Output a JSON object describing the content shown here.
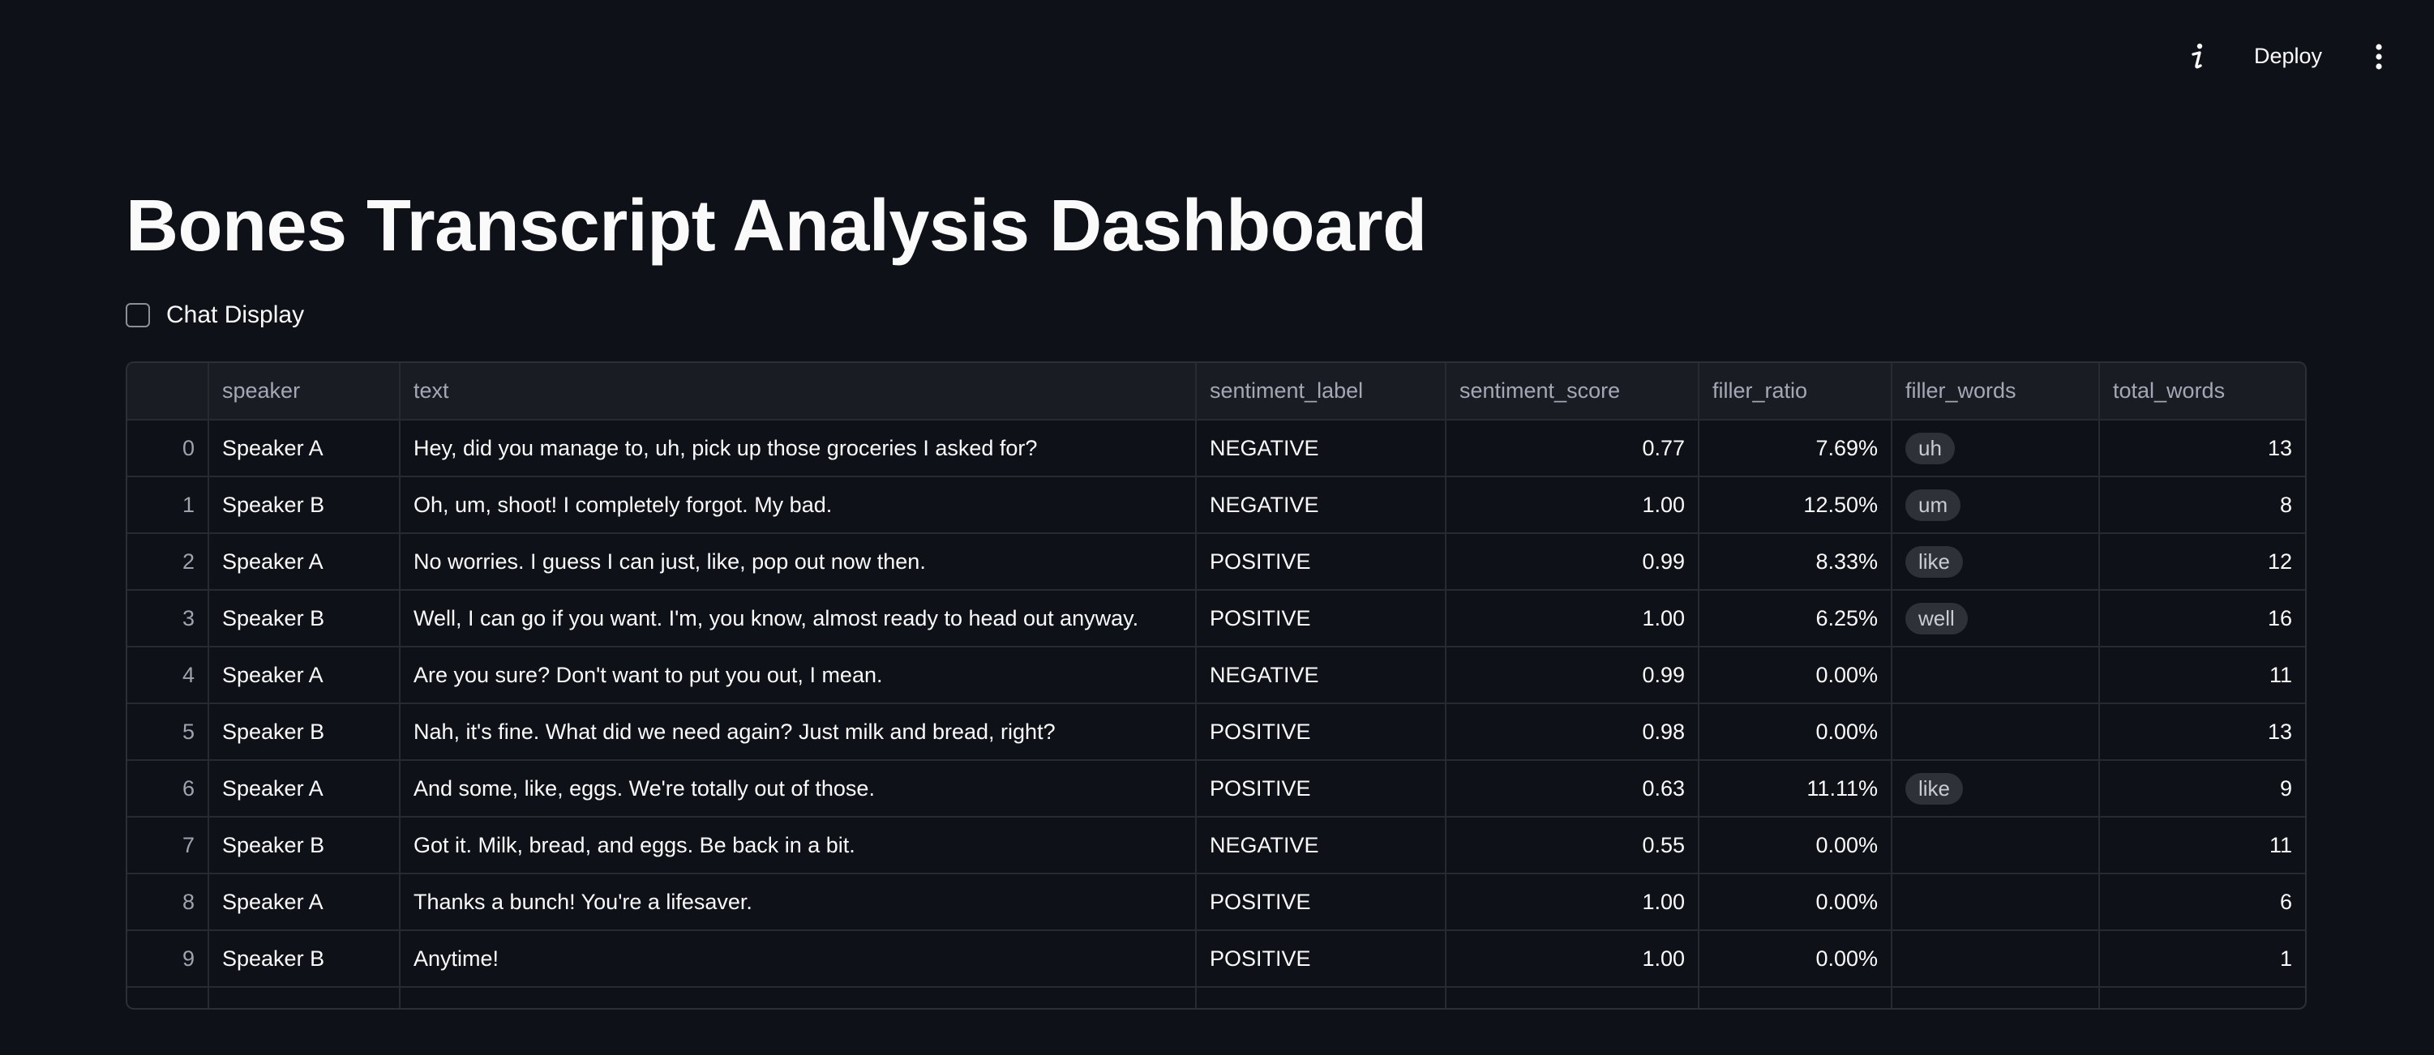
{
  "header": {
    "deploy_label": "Deploy"
  },
  "page": {
    "title": "Bones Transcript Analysis Dashboard",
    "chat_display_label": "Chat Display"
  },
  "table": {
    "columns": [
      "",
      "speaker",
      "text",
      "sentiment_label",
      "sentiment_score",
      "filler_ratio",
      "filler_words",
      "total_words"
    ],
    "rows": [
      {
        "idx": "0",
        "speaker": "Speaker A",
        "text": "Hey, did you manage to, uh, pick up those groceries I asked for?",
        "sentiment_label": "NEGATIVE",
        "sentiment_score": "0.77",
        "filler_ratio": "7.69%",
        "filler_words": "uh",
        "total_words": "13"
      },
      {
        "idx": "1",
        "speaker": "Speaker B",
        "text": "Oh, um, shoot! I completely forgot. My bad.",
        "sentiment_label": "NEGATIVE",
        "sentiment_score": "1.00",
        "filler_ratio": "12.50%",
        "filler_words": "um",
        "total_words": "8"
      },
      {
        "idx": "2",
        "speaker": "Speaker A",
        "text": "No worries. I guess I can just, like, pop out now then.",
        "sentiment_label": "POSITIVE",
        "sentiment_score": "0.99",
        "filler_ratio": "8.33%",
        "filler_words": "like",
        "total_words": "12"
      },
      {
        "idx": "3",
        "speaker": "Speaker B",
        "text": "Well, I can go if you want. I'm, you know, almost ready to head out anyway.",
        "sentiment_label": "POSITIVE",
        "sentiment_score": "1.00",
        "filler_ratio": "6.25%",
        "filler_words": "well",
        "total_words": "16"
      },
      {
        "idx": "4",
        "speaker": "Speaker A",
        "text": "Are you sure? Don't want to put you out, I mean.",
        "sentiment_label": "NEGATIVE",
        "sentiment_score": "0.99",
        "filler_ratio": "0.00%",
        "filler_words": "",
        "total_words": "11"
      },
      {
        "idx": "5",
        "speaker": "Speaker B",
        "text": "Nah, it's fine. What did we need again? Just milk and bread, right?",
        "sentiment_label": "POSITIVE",
        "sentiment_score": "0.98",
        "filler_ratio": "0.00%",
        "filler_words": "",
        "total_words": "13"
      },
      {
        "idx": "6",
        "speaker": "Speaker A",
        "text": "And some, like, eggs. We're totally out of those.",
        "sentiment_label": "POSITIVE",
        "sentiment_score": "0.63",
        "filler_ratio": "11.11%",
        "filler_words": "like",
        "total_words": "9"
      },
      {
        "idx": "7",
        "speaker": "Speaker B",
        "text": "Got it. Milk, bread, and eggs. Be back in a bit.",
        "sentiment_label": "NEGATIVE",
        "sentiment_score": "0.55",
        "filler_ratio": "0.00%",
        "filler_words": "",
        "total_words": "11"
      },
      {
        "idx": "8",
        "speaker": "Speaker A",
        "text": "Thanks a bunch! You're a lifesaver.",
        "sentiment_label": "POSITIVE",
        "sentiment_score": "1.00",
        "filler_ratio": "0.00%",
        "filler_words": "",
        "total_words": "6"
      },
      {
        "idx": "9",
        "speaker": "Speaker B",
        "text": "Anytime!",
        "sentiment_label": "POSITIVE",
        "sentiment_score": "1.00",
        "filler_ratio": "0.00%",
        "filler_words": "",
        "total_words": "1"
      }
    ]
  },
  "icons": {
    "info": "info-icon",
    "menu": "more-vertical-icon"
  }
}
